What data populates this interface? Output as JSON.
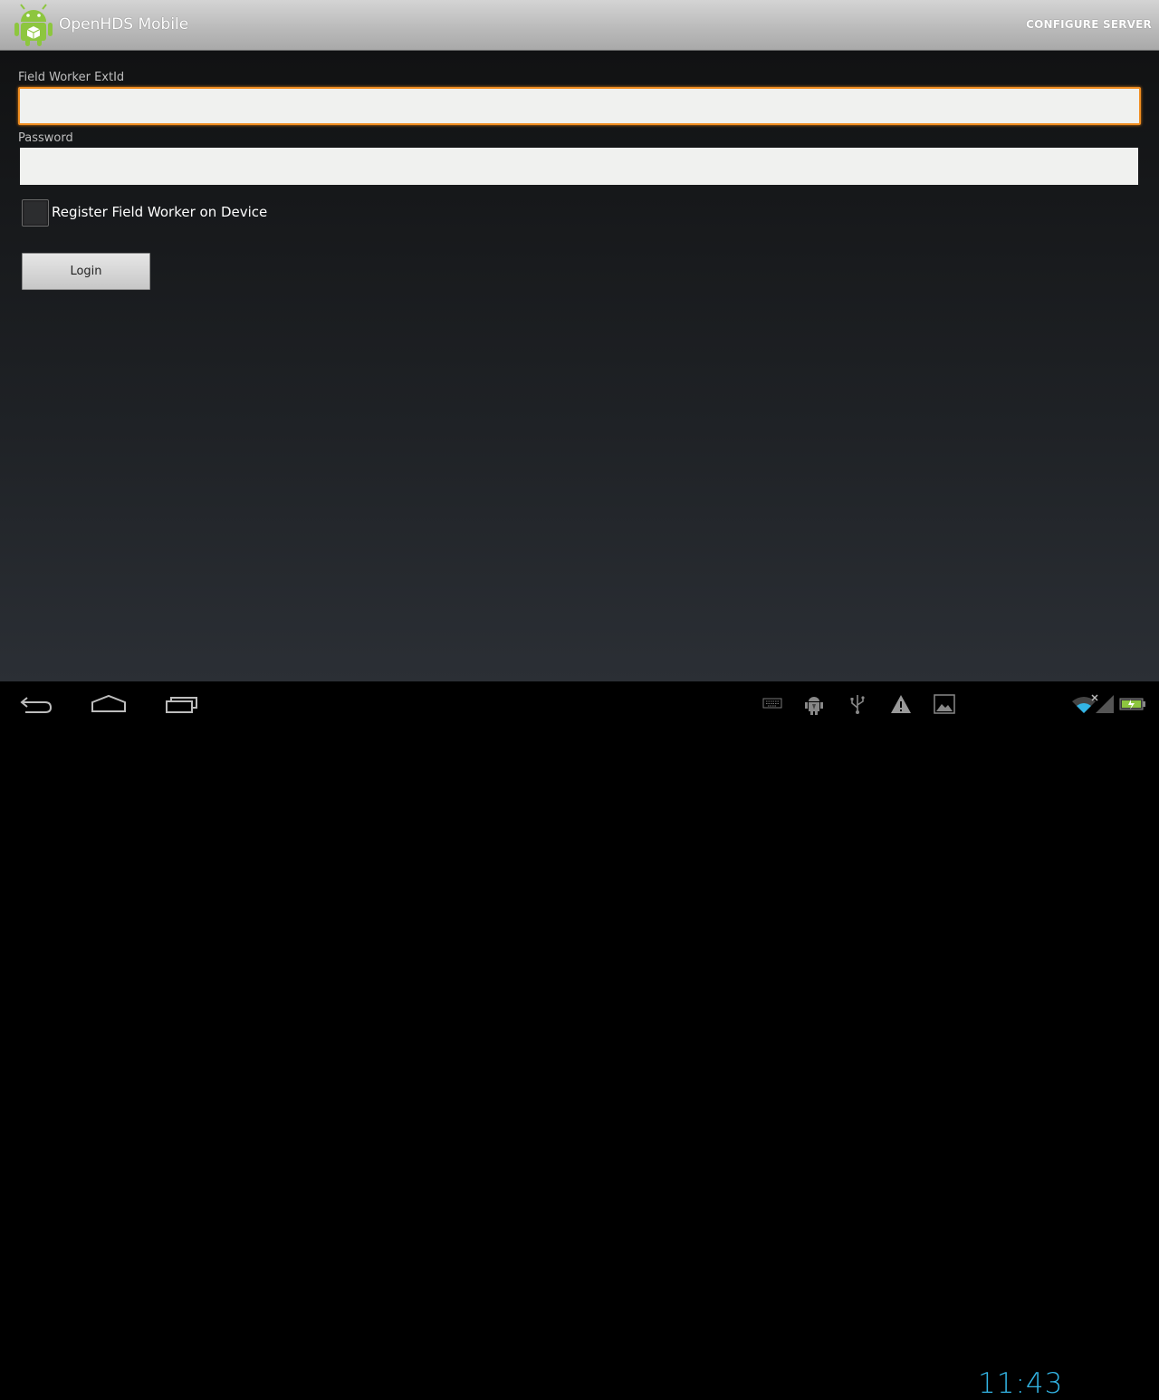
{
  "app": {
    "title": "OpenHDS Mobile",
    "configure_label": "CONFIGURE SERVER",
    "icon": "android-icon"
  },
  "form": {
    "extid_label": "Field Worker ExtId",
    "extid_value": "",
    "password_label": "Password",
    "password_value": "",
    "register_label": "Register Field Worker on Device",
    "register_checked": false,
    "login_label": "Login"
  },
  "system_bar": {
    "clock": "11:43",
    "nav_icons": [
      "back-icon",
      "home-icon",
      "recent-apps-icon"
    ],
    "status_icons": [
      "keyboard-icon",
      "android-debug-icon",
      "usb-icon",
      "warning-icon",
      "gallery-icon",
      "wifi-icon",
      "signal-icon",
      "battery-icon"
    ]
  },
  "colors": {
    "focus_accent": "#f18e21",
    "clock": "#33b5e5",
    "battery": "#8dc63f"
  }
}
